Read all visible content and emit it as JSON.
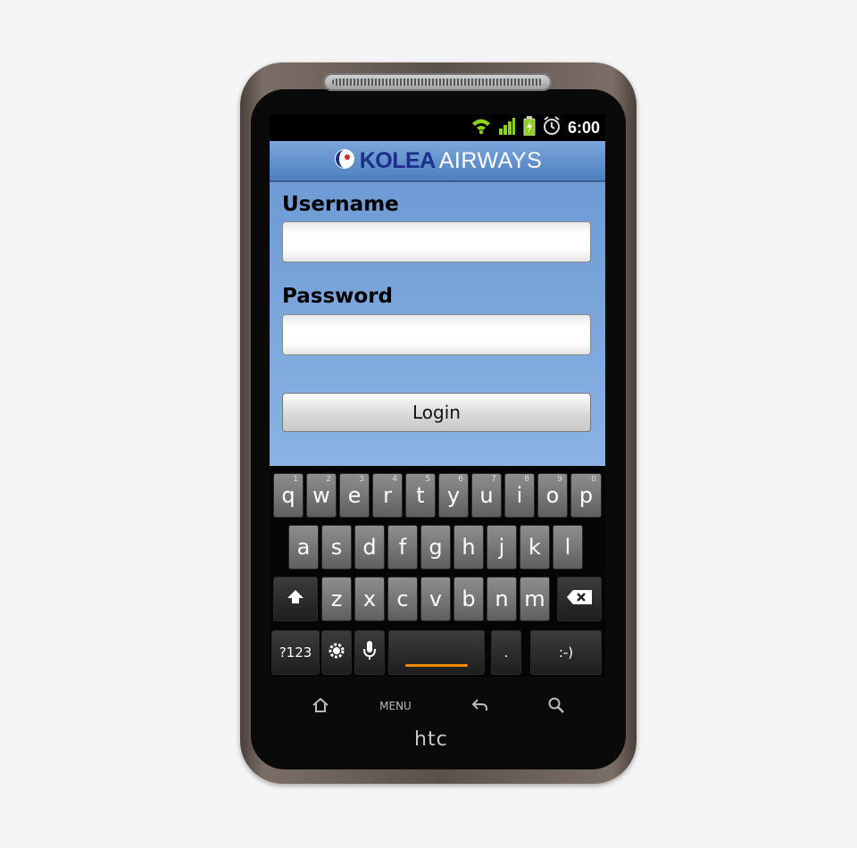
{
  "status_bar": {
    "time": "6:00",
    "icons": [
      "wifi-icon",
      "signal-icon",
      "battery-charging-icon",
      "alarm-icon"
    ],
    "colors": {
      "wifi": "#8ed11b",
      "signal": "#8ed11b",
      "battery": "#8ed11b"
    }
  },
  "header": {
    "logo_brand": "KOLEA",
    "logo_suffix": "AIRWAYS",
    "colors": {
      "bar": "#5f8fcd",
      "brand": "#1b2f8a",
      "suffix": "#ffffff"
    }
  },
  "login_form": {
    "username_label": "Username",
    "username_value": "",
    "password_label": "Password",
    "password_value": "",
    "login_label": "Login",
    "colors": {
      "background": "#7aa6db"
    }
  },
  "keyboard": {
    "row1": [
      {
        "label": "q",
        "hint": "1"
      },
      {
        "label": "w",
        "hint": "2"
      },
      {
        "label": "e",
        "hint": "3"
      },
      {
        "label": "r",
        "hint": "4"
      },
      {
        "label": "t",
        "hint": "5"
      },
      {
        "label": "y",
        "hint": "6"
      },
      {
        "label": "u",
        "hint": "7"
      },
      {
        "label": "i",
        "hint": "8"
      },
      {
        "label": "o",
        "hint": "9"
      },
      {
        "label": "p",
        "hint": "0"
      }
    ],
    "row2": [
      "a",
      "s",
      "d",
      "f",
      "g",
      "h",
      "j",
      "k",
      "l"
    ],
    "row3": [
      "z",
      "x",
      "c",
      "v",
      "b",
      "n",
      "m"
    ],
    "symbols_label": "?123",
    "smiley_label": ":-)",
    "period_label": ".",
    "shift_icon": "shift-icon",
    "backspace_icon": "backspace-icon",
    "settings_icon": "settings-icon",
    "mic_icon": "microphone-icon",
    "accent_color": "#f08a00"
  },
  "navbar": {
    "home_icon": "home-icon",
    "menu_label": "MENU",
    "back_icon": "back-icon",
    "search_icon": "search-icon"
  },
  "device_brand": "htc"
}
